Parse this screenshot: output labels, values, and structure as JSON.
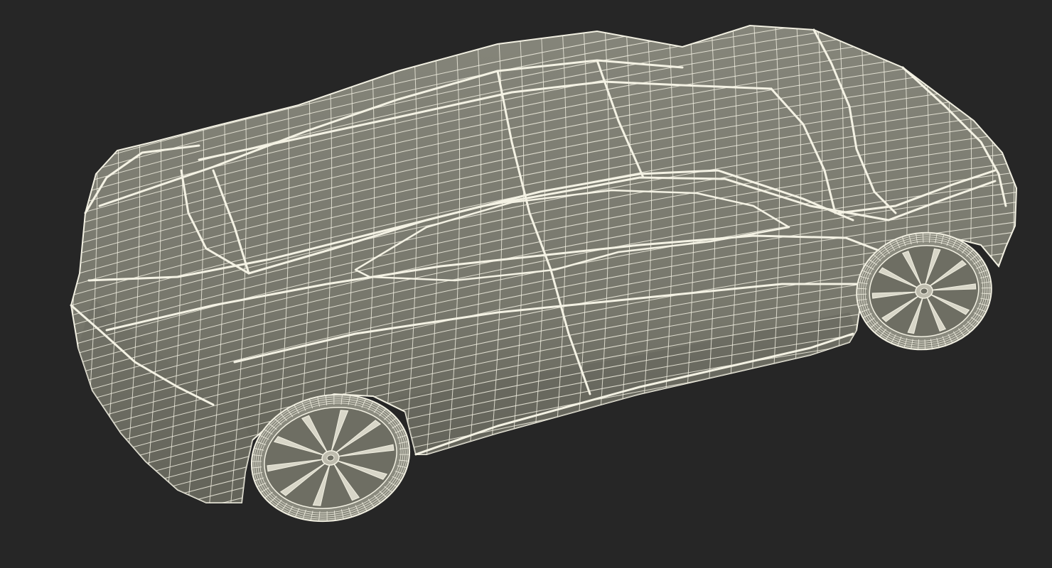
{
  "scene": {
    "subject": "car-wireframe-render",
    "background_color": "#262626",
    "body_color": "#7d7d70",
    "body_shadow_color": "#5f5f55",
    "wire_color": "#f2f0e2",
    "rim_color": "#6e6e63",
    "tire_color": "#8a8a7e"
  }
}
